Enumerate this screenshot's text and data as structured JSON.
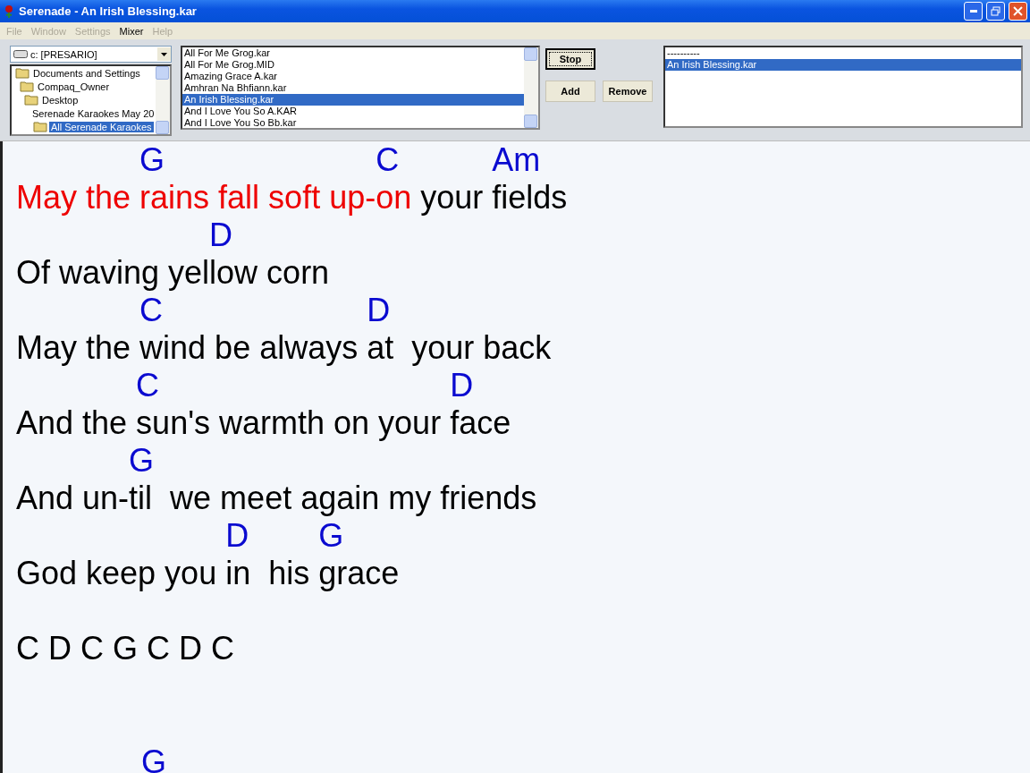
{
  "window": {
    "title": "Serenade - An Irish Blessing.kar"
  },
  "menu": [
    {
      "label": "File",
      "disabled": true
    },
    {
      "label": "Window",
      "disabled": true
    },
    {
      "label": "Settings",
      "disabled": true
    },
    {
      "label": "Mixer",
      "disabled": false
    },
    {
      "label": "Help",
      "disabled": true
    }
  ],
  "drive": {
    "value": "c: [PRESARIO]"
  },
  "folders": [
    {
      "label": "Documents and Settings",
      "selected": false,
      "children": [
        {
          "label": "Compaq_Owner",
          "selected": false,
          "children": [
            {
              "label": "Desktop",
              "selected": false,
              "children": [
                {
                  "label": "Serenade Karaokes May 20",
                  "selected": false,
                  "children": [
                    {
                      "label": "All Serenade Karaokes",
                      "selected": true
                    }
                  ]
                }
              ]
            }
          ]
        }
      ]
    }
  ],
  "files": [
    {
      "label": "All For Me Grog.kar",
      "selected": false
    },
    {
      "label": "All For Me Grog.MID",
      "selected": false
    },
    {
      "label": "Amazing Grace A.kar",
      "selected": false
    },
    {
      "label": "Amhran Na Bhfiann.kar",
      "selected": false
    },
    {
      "label": "An Irish Blessing.kar",
      "selected": true
    },
    {
      "label": "And I Love You So A.KAR",
      "selected": false
    },
    {
      "label": "And I Love You So Bb.kar",
      "selected": false
    }
  ],
  "buttons": [
    {
      "label": "Stop",
      "focused": true
    },
    {
      "label": "Add",
      "focused": false
    },
    {
      "label": "Remove",
      "focused": false
    }
  ],
  "playlist": [
    {
      "label": "----------",
      "selected": false
    },
    {
      "label": "An Irish Blessing.kar",
      "selected": true
    }
  ],
  "lyrics": [
    {
      "kind": "verse",
      "segments": [
        {
          "text": "May the ",
          "sung": true
        },
        {
          "chord": "G",
          "text": "rains fall soft up-",
          "sung": true
        },
        {
          "chord": "C",
          "text": "on",
          "sung": true
        },
        {
          "text": " your ",
          "sung": false
        },
        {
          "chord": "Am",
          "text": "fields",
          "sung": false
        }
      ]
    },
    {
      "kind": "verse",
      "segments": [
        {
          "text": "Of waving yel",
          "sung": false
        },
        {
          "chord": "D",
          "text": "low corn",
          "sung": false
        }
      ]
    },
    {
      "kind": "verse",
      "segments": [
        {
          "text": "May the ",
          "sung": false
        },
        {
          "chord": "C",
          "text": "wind be always ",
          "sung": false
        },
        {
          "chord": "D",
          "text": "at  your back",
          "sung": false
        }
      ]
    },
    {
      "kind": "verse",
      "segments": [
        {
          "text": "And the ",
          "sung": false
        },
        {
          "chord": "C",
          "text": "sun's warmth on your ",
          "sung": false
        },
        {
          "chord": "D",
          "text": "face",
          "sung": false
        }
      ]
    },
    {
      "kind": "verse",
      "segments": [
        {
          "text": "And un-",
          "sung": false
        },
        {
          "chord": "G",
          "text": "til  we meet again my friends",
          "sung": false
        }
      ]
    },
    {
      "kind": "verse",
      "segments": [
        {
          "text": "God keep you ",
          "sung": false
        },
        {
          "chord": "D",
          "text": "in  his ",
          "sung": false
        },
        {
          "chord": "G",
          "text": "grace",
          "sung": false
        }
      ]
    },
    {
      "kind": "verse",
      "segments": [
        {
          "text": "C D C G C D C",
          "sung": false
        }
      ]
    },
    {
      "kind": "blank"
    },
    {
      "kind": "chords",
      "segments": [
        {
          "chord": "G"
        }
      ]
    }
  ]
}
